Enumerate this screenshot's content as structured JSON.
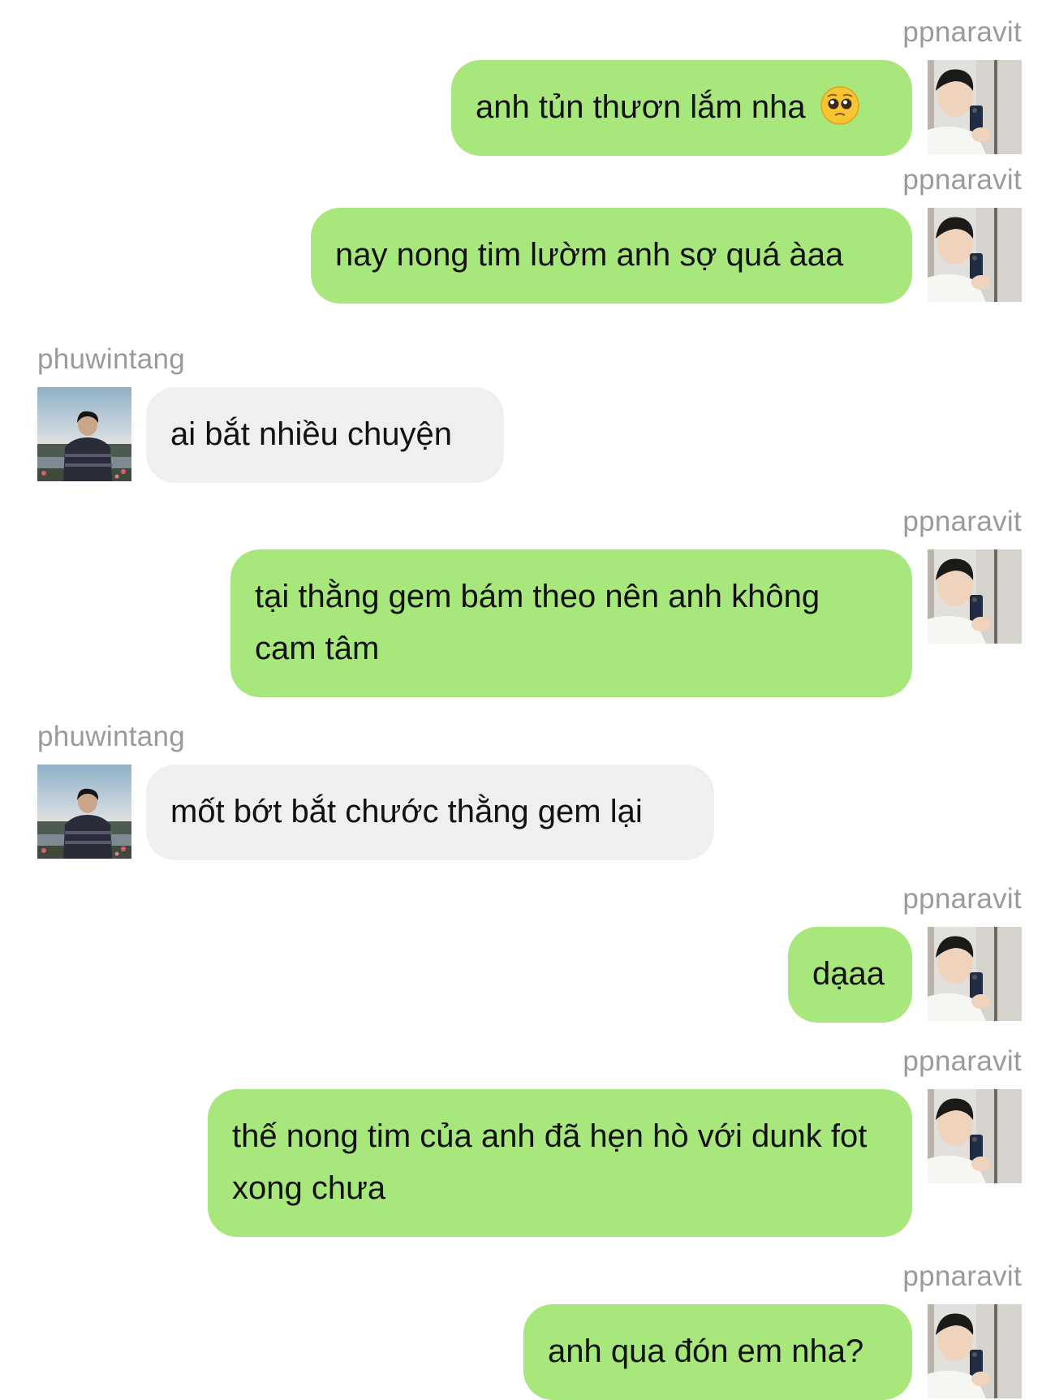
{
  "chat": {
    "messages": [
      {
        "sender": "ppnaravit",
        "direction": "out",
        "text": "anh tủn thươn lắm nha",
        "emoji": "pleading-face-icon"
      },
      {
        "sender": "ppnaravit",
        "direction": "out",
        "text": "nay nong tim lườm anh sợ quá àaa"
      },
      {
        "sender": "phuwintang",
        "direction": "in",
        "text": "ai bắt nhiều chuyện"
      },
      {
        "sender": "ppnaravit",
        "direction": "out",
        "text": "tại thằng gem bám theo nên anh không cam tâm"
      },
      {
        "sender": "phuwintang",
        "direction": "in",
        "text": "mốt bớt bắt chước thằng gem lại"
      },
      {
        "sender": "ppnaravit",
        "direction": "out",
        "text": "dạaa"
      },
      {
        "sender": "ppnaravit",
        "direction": "out",
        "text": "thế nong tim của anh đã hẹn hò với dunk fot xong chưa"
      },
      {
        "sender": "ppnaravit",
        "direction": "out",
        "text": "anh qua đón em nha?"
      }
    ]
  },
  "colors": {
    "outgoing_bubble": "#a7e77b",
    "incoming_bubble": "#efefef",
    "username_text": "#9a9a9a",
    "message_text": "#111111",
    "background": "#ffffff"
  }
}
